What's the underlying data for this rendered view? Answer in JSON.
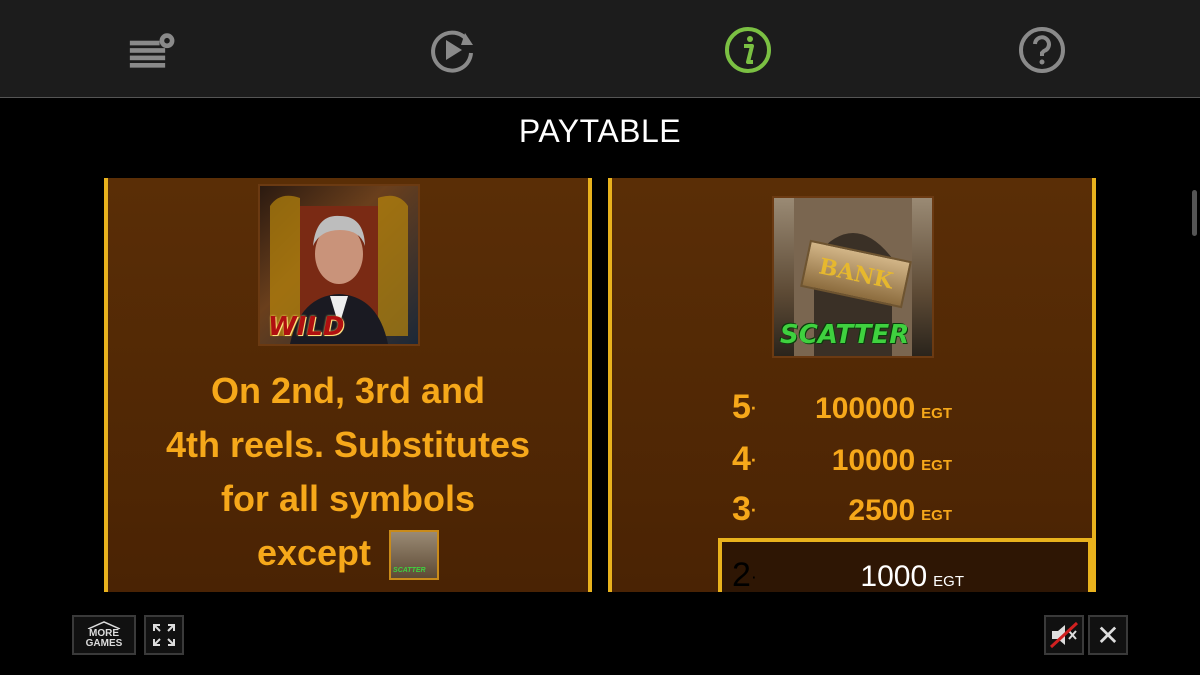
{
  "toolbar": {
    "icons": [
      "settings-icon",
      "autoplay-icon",
      "info-icon",
      "help-icon"
    ],
    "active_color": "#7bc043",
    "icon_color": "#8a8a8a"
  },
  "title": "PAYTABLE",
  "wild_card": {
    "symbol_label": "WILD",
    "description_lines": [
      "On 2nd, 3rd and",
      "4th reels. Substitutes",
      "for all symbols",
      "except"
    ],
    "mini_symbol_label": "SCATTER"
  },
  "scatter_card": {
    "sign_text": "BANK",
    "symbol_label": "SCATTER",
    "payouts": [
      {
        "count": "5",
        "value": "100000",
        "unit": "EGT"
      },
      {
        "count": "4",
        "value": "10000",
        "unit": "EGT"
      },
      {
        "count": "3",
        "value": "2500",
        "unit": "EGT"
      },
      {
        "count": "2",
        "value": "1000",
        "unit": "EGT"
      }
    ]
  },
  "bottom": {
    "more_games_line1": "MORE",
    "more_games_line2": "GAMES",
    "close_glyph": "✕"
  },
  "colors": {
    "accent": "#e9b21d",
    "text_gold": "#f6a81a",
    "panel_bg": "#5a2e06"
  }
}
